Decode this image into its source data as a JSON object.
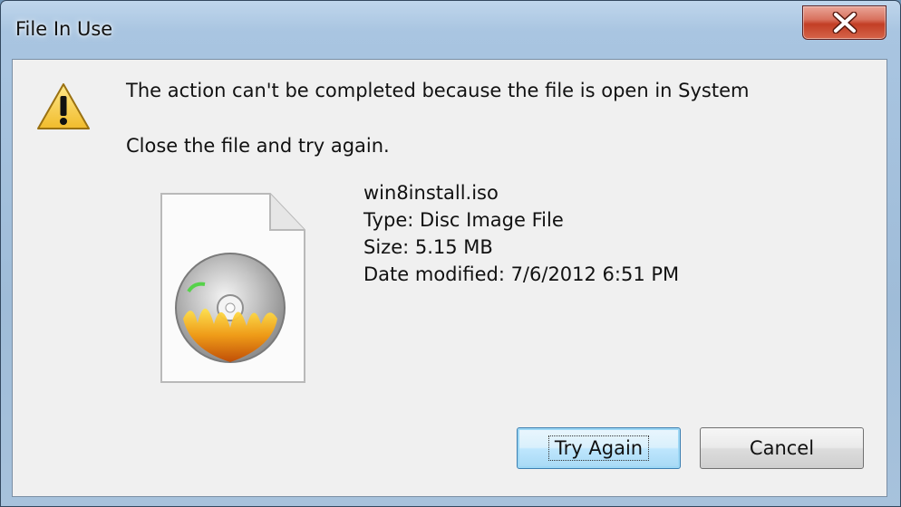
{
  "window": {
    "title": "File In Use",
    "close_icon": "close-icon"
  },
  "dialog": {
    "warning_icon": "warning-icon",
    "message": "The action can't be completed because the file is open in System",
    "instruction": "Close the file and try again.",
    "file": {
      "icon": "disc-image-file-icon",
      "name": "win8install.iso",
      "type": "Type: Disc Image File",
      "size": "Size: 5.15 MB",
      "date_modified": "Date modified: 7/6/2012 6:51 PM"
    },
    "buttons": {
      "try_again": "Try Again",
      "cancel": "Cancel"
    }
  }
}
